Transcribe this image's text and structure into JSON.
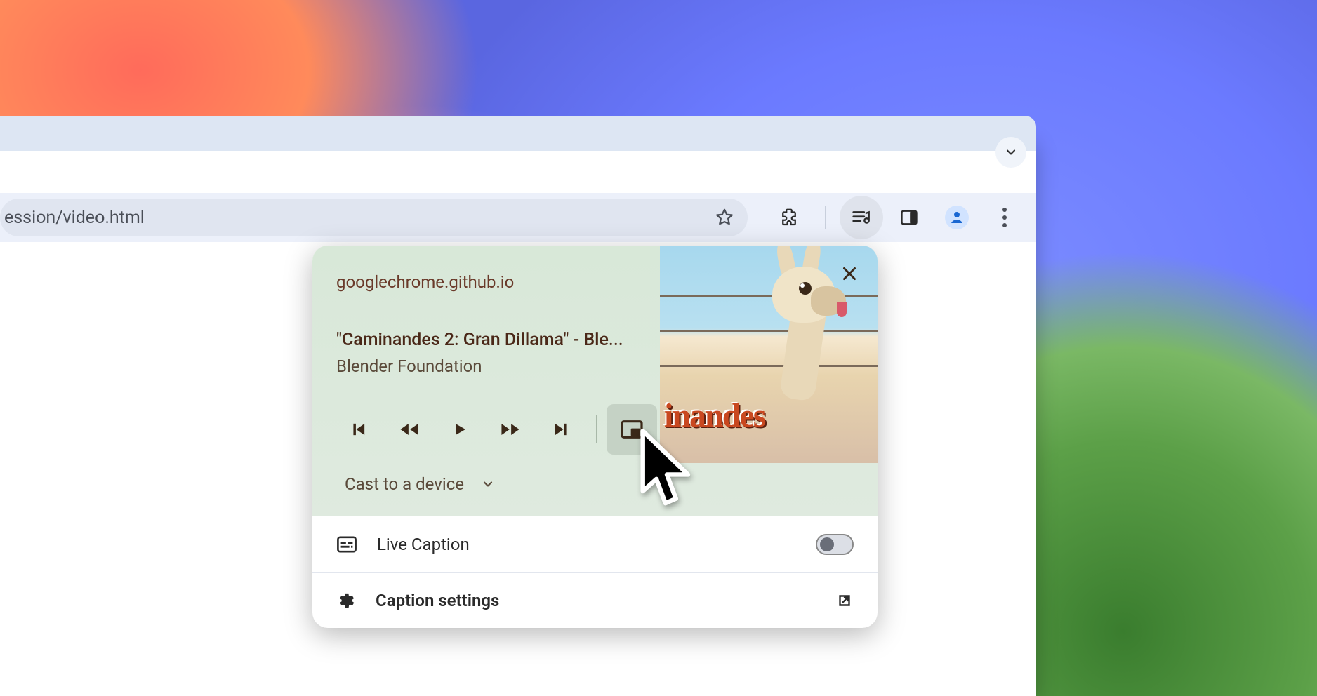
{
  "addressbar": {
    "url_fragment": "ession/video.html"
  },
  "toolbar": {
    "star_icon": "star",
    "extensions_icon": "puzzle",
    "media_icon": "playlist-audio",
    "side_panel_icon": "side-panel",
    "profile_icon": "profile",
    "menu_icon": "three-dots"
  },
  "media_panel": {
    "source": "googlechrome.github.io",
    "title": "\"Caminandes 2: Gran Dillama\" - Ble...",
    "artist": "Blender Foundation",
    "art_logo_text": "inandes",
    "controls": {
      "prev_track": "previous",
      "rewind": "rewind",
      "play": "play",
      "ffwd": "fast-forward",
      "next_track": "next",
      "pip": "picture-in-picture"
    },
    "cast_label": "Cast to a device",
    "live_caption": {
      "label": "Live Caption",
      "enabled": false
    },
    "caption_settings": {
      "label": "Caption settings"
    }
  }
}
